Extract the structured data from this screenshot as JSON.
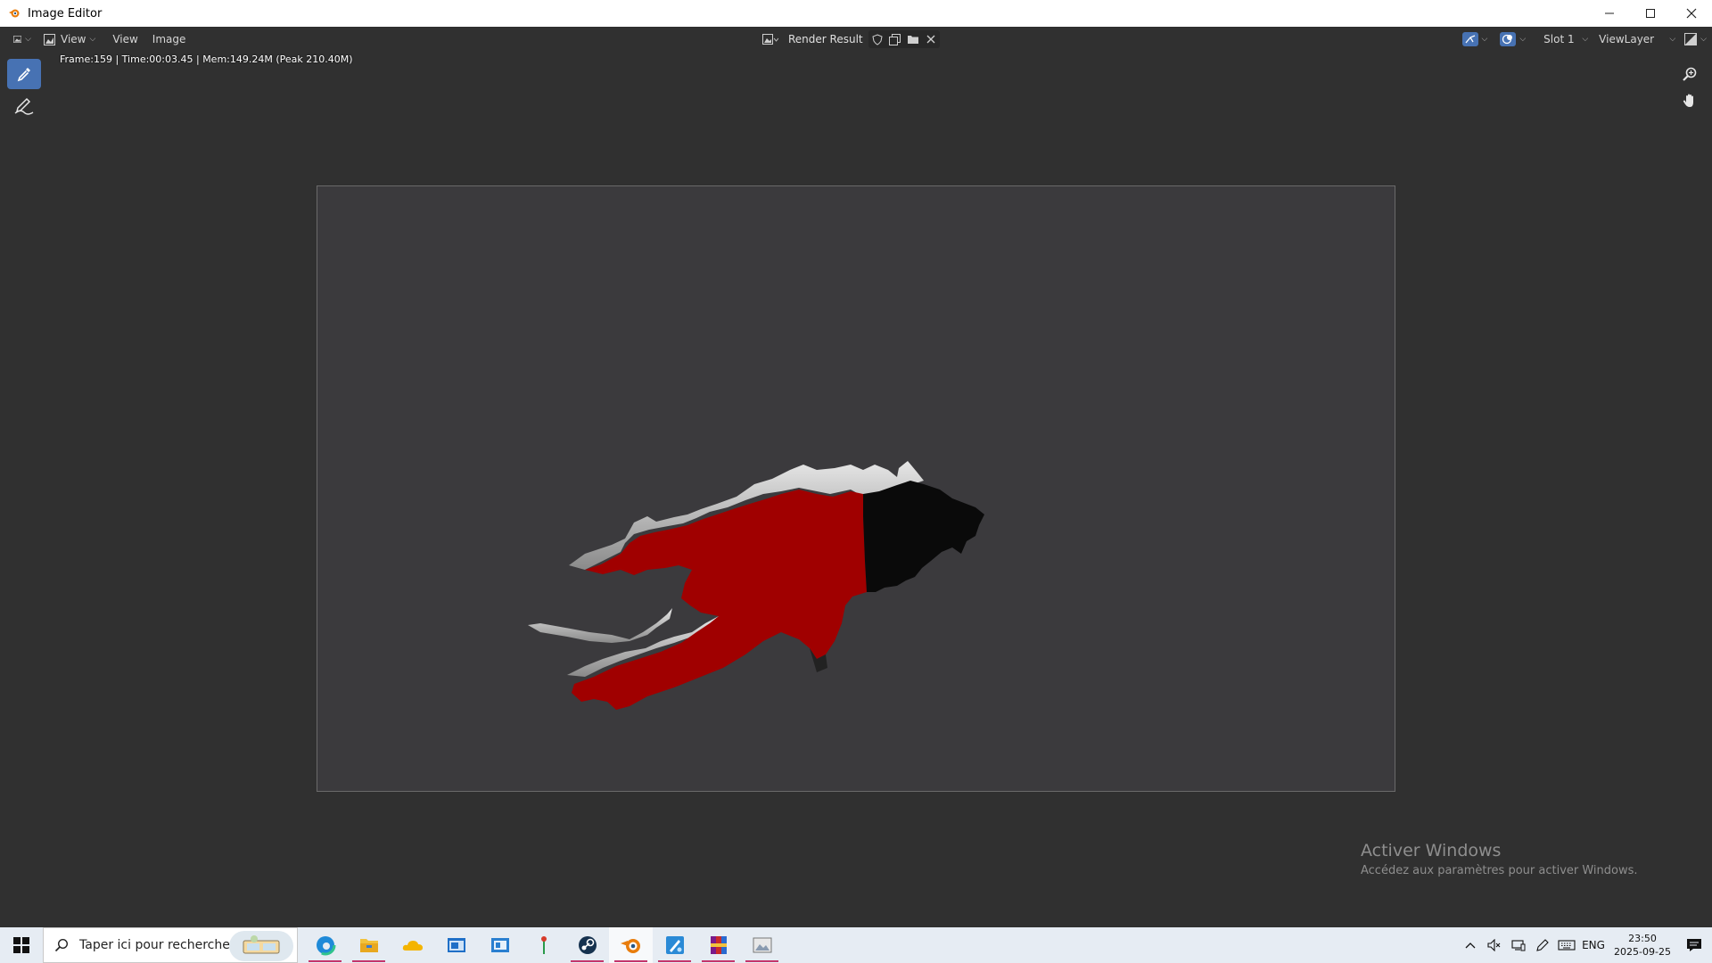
{
  "window": {
    "title": "Image Editor",
    "app_icon": "blender-icon",
    "controls": [
      "minimize-icon",
      "maximize-icon",
      "close-icon"
    ]
  },
  "header": {
    "editor_type_icon": "image-editor-icon",
    "view_mode_label": "View",
    "menus": [
      "View",
      "Image"
    ],
    "image_name": "Render Result",
    "image_actions": [
      "fake-user-shield-icon",
      "new-image-icon",
      "open-folder-icon",
      "unlink-x-icon"
    ],
    "slot_label": "Slot 1",
    "view_layer_label": "ViewLayer",
    "right_icons": [
      "gizmo-icon",
      "overlay-icon",
      "display-channels-icon"
    ]
  },
  "main": {
    "render_info": "Frame:159 | Time:00:03.45 | Mem:149.24M (Peak 210.40M)",
    "tools": [
      {
        "name": "sample-tool",
        "icon": "eyedropper-icon",
        "active": true
      },
      {
        "name": "annotate-tool",
        "icon": "annotate-pen-icon",
        "active": false
      }
    ],
    "nav": [
      "zoom-icon",
      "pan-hand-icon"
    ],
    "render_colors": {
      "background": "#3b3a3d",
      "red": "#a00000",
      "black": "#0a0a0a",
      "edge": "#bdbdbd"
    }
  },
  "watermark": {
    "line1": "Activer Windows",
    "line2": "Accédez aux paramètres pour activer Windows."
  },
  "taskbar": {
    "search_placeholder": "Taper ici pour rechercher",
    "apps": [
      "edge-icon",
      "file-explorer-icon",
      "onedrive-icon",
      "app-blue-window-icon",
      "app-blue-window-2-icon",
      "pin-app-icon",
      "steam-icon",
      "blender-icon",
      "paint-app-icon",
      "winrar-icon",
      "photo-app-icon"
    ],
    "tray_icons": [
      "chevron-up-icon",
      "mute-speaker-icon",
      "network-icon",
      "pen-icon",
      "keyboard-icon"
    ],
    "language": "ENG",
    "time": "23:50",
    "date": "2025-09-25"
  }
}
